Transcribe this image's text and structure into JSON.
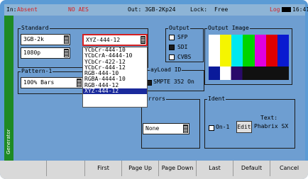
{
  "status": {
    "input": "In:",
    "input_value": "Absent",
    "aes": "NO AES",
    "out": "Out: 3GB-2Kp24",
    "lock": "Lock:",
    "lock_value": "Free",
    "log": "Log",
    "time": "16:41"
  },
  "sidebar": {
    "label": "Generator"
  },
  "standard": {
    "title": "Standard",
    "format": "3GB-2k",
    "rate": "1080p",
    "colour": "XYZ-444-12"
  },
  "colour_dropdown": {
    "options": [
      "YCbCr-444-10",
      "YCbCrA-4444-10",
      "YCbCr-422-12",
      "YCbCr-444-12",
      "RGB-444-10",
      "RGBA-4444-10",
      "RGB-444-12",
      "XYZ-444-12"
    ],
    "selected": "XYZ-444-12"
  },
  "output": {
    "title": "Output",
    "options": [
      "SFP",
      "SDI",
      "CVBS"
    ],
    "selected": "SDI"
  },
  "output_image": {
    "title": "Output Image"
  },
  "pattern": {
    "title": "Pattern-1",
    "value": "100% Bars"
  },
  "payload": {
    "title": "ayLoad ID",
    "value": "SMPTE 352 On"
  },
  "errors": {
    "title": "Errors",
    "value": "None"
  },
  "ident": {
    "title": "Ident",
    "toggle_label": "On-1",
    "edit_label": "Edit",
    "text_label": "Text:",
    "text_value": "Phabrix SX"
  },
  "softkeys": [
    "",
    "",
    "First",
    "Page Up",
    "Page Down",
    "Last",
    "Default",
    "Cancel"
  ],
  "colors": {
    "screen_bg": "#6e9ed1",
    "sidebar": "#1e8a24",
    "highlight": "#1a2a9c",
    "warning": "#d62020"
  }
}
